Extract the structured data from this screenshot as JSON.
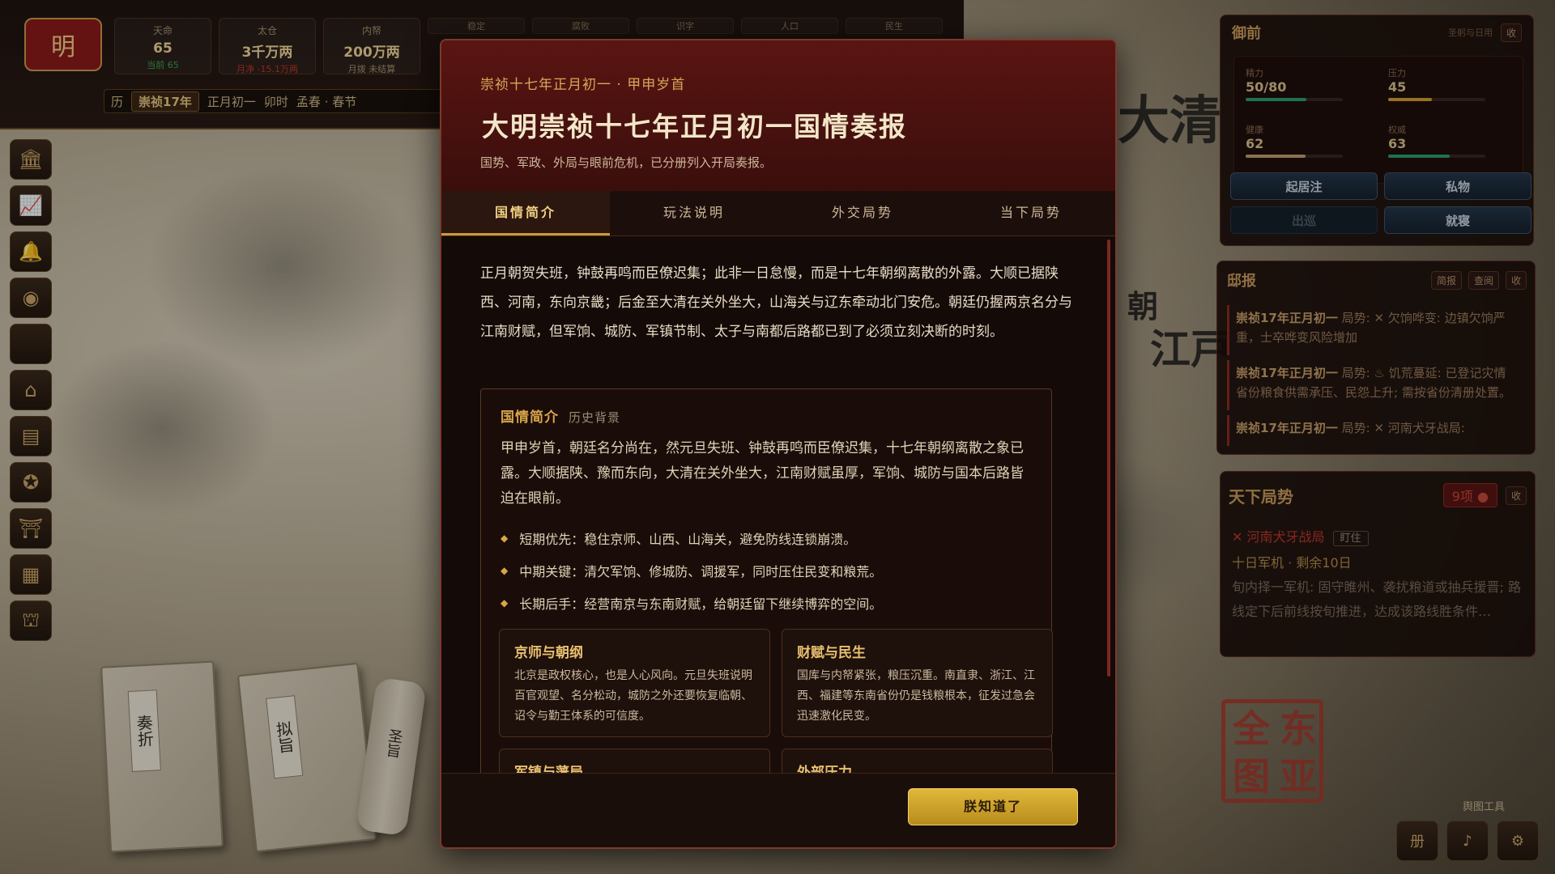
{
  "topbar": {
    "emblem": "明",
    "stats": [
      {
        "label": "天命",
        "value": "65",
        "sub": "当前 65",
        "sub_color": "#3aa64a"
      },
      {
        "label": "太仓",
        "value": "3千万两",
        "sub": "月净 -15.1万两",
        "sub_color": "#c0352c"
      },
      {
        "label": "内帑",
        "value": "200万两",
        "sub": "月拨 未结算",
        "sub_color": "#a89270"
      }
    ],
    "mini": [
      "稳定",
      "腐败",
      "识字",
      "人口",
      "民生"
    ],
    "date": {
      "prefix": "历",
      "year": "崇祯17年",
      "day": "正月初一",
      "hour": "卯时",
      "season": "孟春 · 春节"
    }
  },
  "left_icons": [
    "palace-icon",
    "chart-icon",
    "bell-icon",
    "globe-icon",
    "blank-icon",
    "hall-icon",
    "book-icon",
    "seal-icon",
    "pavilion-icon",
    "scroll-icon",
    "gate-icon"
  ],
  "books": {
    "memorial": "奏折",
    "decree_draft": "拟旨",
    "edict": "圣旨"
  },
  "map_labels": {
    "qing": "大清",
    "chao": "朝",
    "jiang": "江戸"
  },
  "royal_panel": {
    "title": "御前",
    "right_note": "圣躬与日用",
    "collapse": "收",
    "gauges": [
      {
        "label": "精力",
        "value": "50/80",
        "ratio": 0.625,
        "color": "#2aa06a"
      },
      {
        "label": "压力",
        "value": "45",
        "ratio": 0.45,
        "color": "#d0a030"
      },
      {
        "label": "健康",
        "value": "62",
        "ratio": 0.62,
        "color": "#c0a070"
      },
      {
        "label": "权威",
        "value": "63",
        "ratio": 0.63,
        "color": "#2aa06a"
      }
    ],
    "buttons": [
      {
        "label": "起居注",
        "disabled": false
      },
      {
        "label": "私物",
        "disabled": false
      },
      {
        "label": "出巡",
        "disabled": true
      },
      {
        "label": "就寝",
        "disabled": false
      }
    ]
  },
  "gazette_panel": {
    "title": "邸报",
    "buttons": [
      "简报",
      "查阅",
      "收"
    ],
    "items": [
      {
        "head": "崇祯17年正月初一",
        "text": " 局势: ✕ 欠饷哗变: 边镇欠饷严重，士卒哗变风险增加"
      },
      {
        "head": "崇祯17年正月初一",
        "text": " 局势: ♨ 饥荒蔓延: 已登记灾情省份粮食供需承压、民怨上升; 需按省份清册处置。"
      },
      {
        "head": "崇祯17年正月初一",
        "text": " 局势: ✕ 河南犬牙战局:"
      }
    ]
  },
  "world_panel": {
    "title": "天下局势",
    "badge": "9项 ●",
    "collapse": "收",
    "event": {
      "name": "河南犬牙战局",
      "watch": "盯住",
      "countdown": "十日军机 · 剩余10日",
      "desc": "旬内择一军机: 固守睢州、袭扰粮道或抽兵援晋; 路线定下后前线按旬推进，达成该路线胜条件…"
    }
  },
  "seal_text": [
    "东",
    "亚",
    "全",
    "图"
  ],
  "map_tools": "舆图工具",
  "bottom_icons": [
    "册",
    "♪",
    "⚙"
  ],
  "modal": {
    "kicker": "崇祯十七年正月初一 · 甲申岁首",
    "title": "大明崇祯十七年正月初一国情奏报",
    "subtitle": "国势、军政、外局与眼前危机，已分册列入开局奏报。",
    "tabs": [
      "国情简介",
      "玩法说明",
      "外交局势",
      "当下局势"
    ],
    "active_tab": 0,
    "lead": "正月朝贺失班，钟鼓再鸣而臣僚迟集；此非一日怠慢，而是十七年朝纲离散的外露。大顺已据陕西、河南，东向京畿；后金至大清在关外坐大，山海关与辽东牵动北门安危。朝廷仍握两京名分与江南财赋，但军饷、城防、军镇节制、太子与南都后路都已到了必须立刻决断的时刻。",
    "section": {
      "title": "国情简介",
      "tag": "历史背景",
      "text": "甲申岁首，朝廷名分尚在，然元旦失班、钟鼓再鸣而臣僚迟集，十七年朝纲离散之象已露。大顺据陕、豫而东向，大清在关外坐大，江南财赋虽厚，军饷、城防与国本后路皆迫在眼前。",
      "bullets": [
        "短期优先：稳住京师、山西、山海关，避免防线连锁崩溃。",
        "中期关键：清欠军饷、修城防、调援军，同时压住民变和粮荒。",
        "长期后手：经营南京与东南财赋，给朝廷留下继续博弈的空间。"
      ],
      "cards": [
        {
          "title": "京师与朝纲",
          "body": "北京是政权核心，也是人心风向。元旦失班说明百官观望、名分松动，城防之外还要恢复临朝、诏令与勤王体系的可信度。"
        },
        {
          "title": "财赋与民生",
          "body": "国库与内帑紧张，粮压沉重。南直隶、浙江、江西、福建等东南省份仍是钱粮根本，征发过急会迅速激化民变。"
        },
        {
          "title": "军镇与藩局",
          "body": ""
        },
        {
          "title": "外部压力",
          "body": ""
        }
      ]
    },
    "confirm": "朕知道了"
  }
}
